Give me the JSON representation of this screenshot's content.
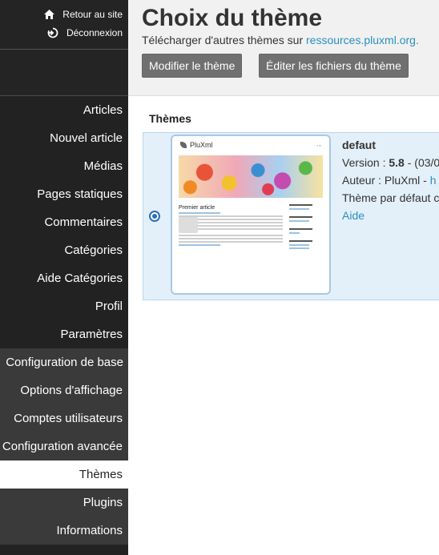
{
  "sidebar": {
    "back_to_site": "Retour au site",
    "logout": "Déconnexion",
    "menu": [
      {
        "label": "Articles"
      },
      {
        "label": "Nouvel article"
      },
      {
        "label": "Médias"
      },
      {
        "label": "Pages statiques"
      },
      {
        "label": "Commentaires"
      },
      {
        "label": "Catégories"
      },
      {
        "label": "Aide Catégories"
      },
      {
        "label": "Profil"
      },
      {
        "label": "Paramètres"
      }
    ],
    "submenu": [
      {
        "label": "Configuration de base"
      },
      {
        "label": "Options d'affichage"
      },
      {
        "label": "Comptes utilisateurs"
      },
      {
        "label": "Configuration avancée"
      },
      {
        "label": "Thèmes"
      },
      {
        "label": "Plugins"
      },
      {
        "label": "Informations"
      }
    ],
    "active_item": "Thèmes"
  },
  "header": {
    "title": "Choix du thème",
    "download_text": "Télécharger d'autres thèmes sur",
    "download_link": "ressources.pluxml.org.",
    "btn_modify": "Modifier le thème",
    "btn_edit_files": "Éditer les fichiers du thème"
  },
  "themes": {
    "heading": "Thèmes",
    "items": [
      {
        "name": "defaut",
        "version_label": "Version :",
        "version": "5.8",
        "version_suffix": " - (03/0",
        "author_label": "Auteur : PluXml - ",
        "author_link": "h",
        "description": "Thème par défaut c",
        "help_link": "Aide",
        "selected": true,
        "thumbnail": {
          "site_name": "PluXml",
          "article_title": "Premier article"
        }
      }
    ]
  },
  "colors": {
    "sidebar_bg": "#222222",
    "sidebar_sub_bg": "#3a3a3a",
    "link": "#2a8fbd",
    "selected_row": "#e3f0fa",
    "button_bg": "#707070"
  }
}
